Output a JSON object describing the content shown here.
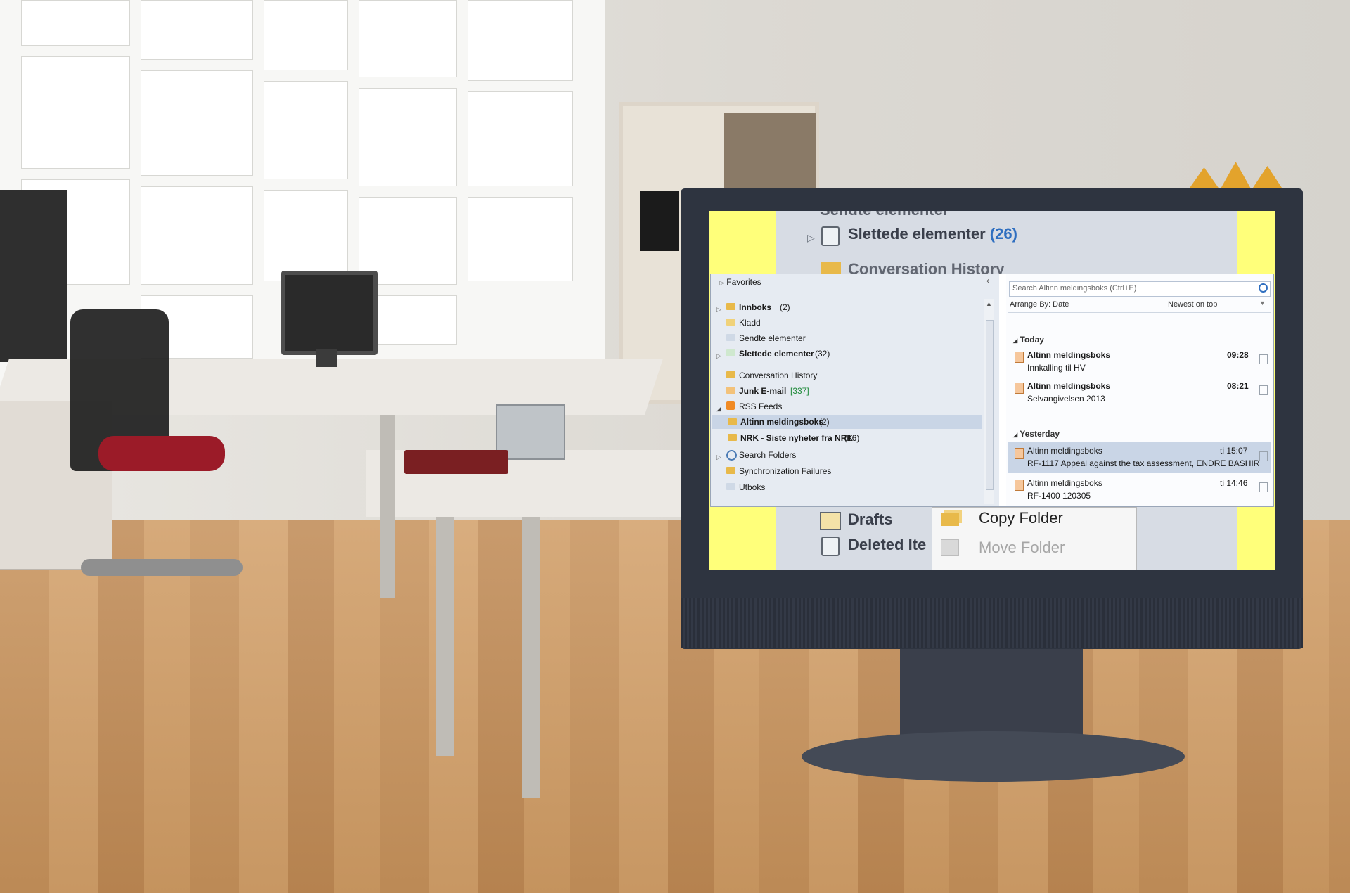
{
  "screen_top": {
    "sendte_partial": "Sendte elementer",
    "slettede_label": "Slettede elementer",
    "slettede_count": "(26)",
    "conversation_partial": "Conversation History"
  },
  "left_pane": {
    "favorites_label": "Favorites",
    "folders": [
      {
        "label": "Innboks",
        "count": "(2)",
        "bold": true
      },
      {
        "label": "Kladd",
        "count": ""
      },
      {
        "label": "Sendte elementer",
        "count": ""
      },
      {
        "label": "Slettede elementer",
        "count": "(32)",
        "bold": true
      },
      {
        "label": "Conversation History",
        "count": ""
      },
      {
        "label": "Junk E-mail",
        "count": "[337]",
        "bold": true
      },
      {
        "label": "RSS Feeds",
        "count": ""
      },
      {
        "label": "Altinn meldingsboks",
        "count": "(2)",
        "bold": true
      },
      {
        "label": "NRK - Siste nyheter fra NRK",
        "count": "(16)",
        "bold": true
      },
      {
        "label": "Search Folders",
        "count": ""
      },
      {
        "label": "Synchronization Failures",
        "count": ""
      },
      {
        "label": "Utboks",
        "count": ""
      }
    ]
  },
  "right_pane": {
    "search_placeholder": "Search Altinn meldingsboks (Ctrl+E)",
    "arrange_label": "Arrange By: Date",
    "sort_label": "Newest on top",
    "groups": [
      {
        "label": "Today"
      },
      {
        "label": "Yesterday"
      }
    ],
    "messages": [
      {
        "sender": "Altinn meldingsboks",
        "subject": "Innkalling til HV",
        "time": "09:28"
      },
      {
        "sender": "Altinn meldingsboks",
        "subject": "Selvangivelsen 2013",
        "time": "08:21"
      },
      {
        "sender": "Altinn meldingsboks",
        "subject": "RF-1117 Appeal against the tax assessment, ENDRE BASHIR",
        "time": "ti 15:07"
      },
      {
        "sender": "Altinn meldingsboks",
        "subject": "RF-1400 120305",
        "time": "ti 14:46"
      }
    ]
  },
  "screen_bottom": {
    "drafts_label": "Drafts",
    "deleted_partial": "Deleted Ite",
    "menu_copy": "Copy Folder",
    "menu_move": "Move Folder"
  },
  "colors": {
    "screen_highlight": "#ffff7a",
    "link_blue": "#2f6fc0",
    "selected_row": "#c9d5e6"
  }
}
